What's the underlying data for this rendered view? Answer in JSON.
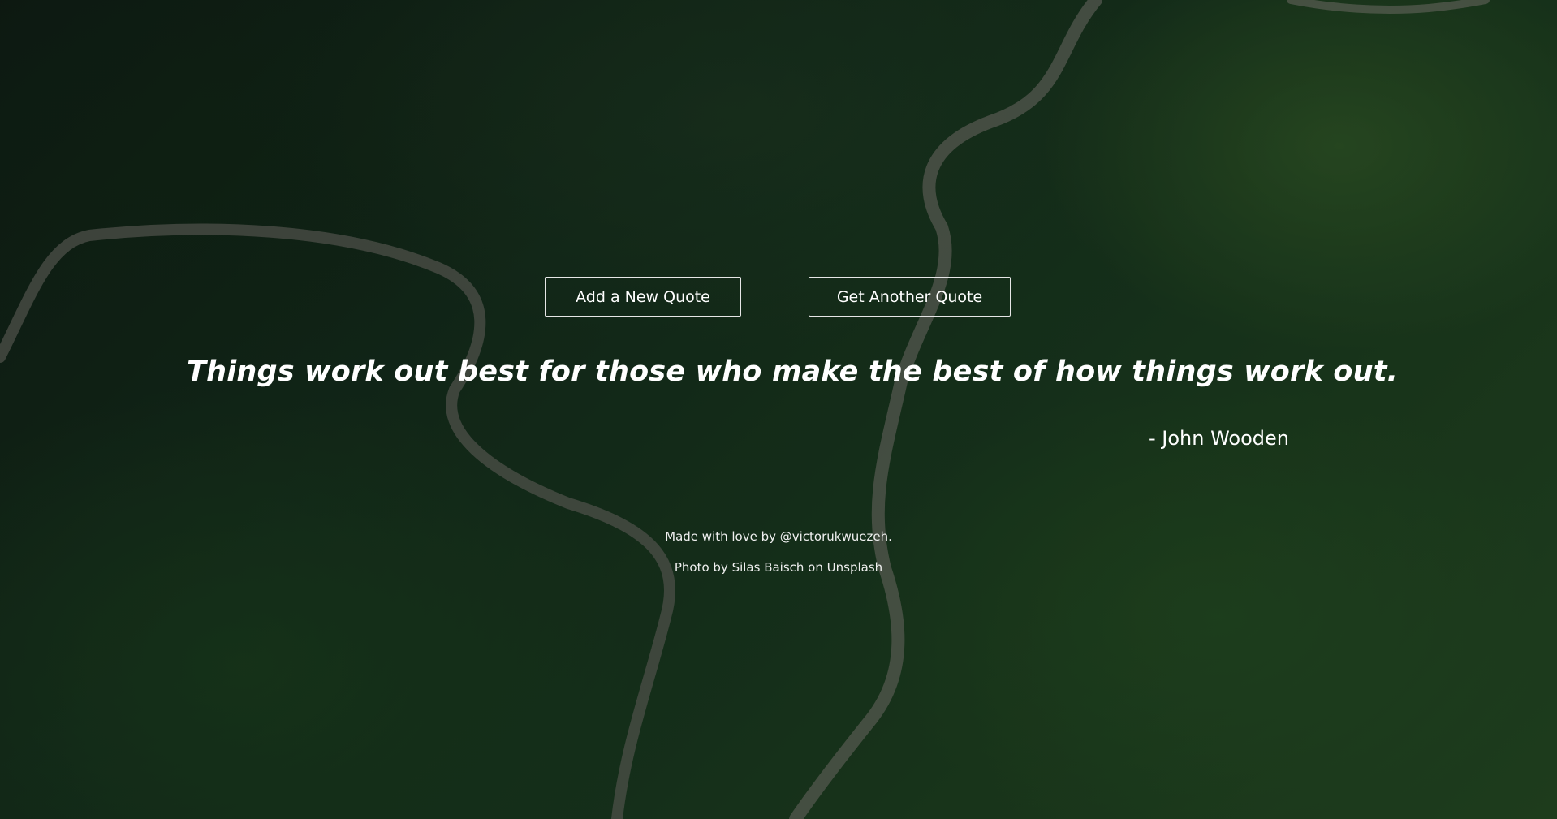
{
  "buttons": {
    "add_quote": "Add a New Quote",
    "another_quote": "Get Another Quote"
  },
  "quote": {
    "text": "Things work out best for those who make the best of how things work out.",
    "author": "- John Wooden"
  },
  "footer": {
    "credit": "Made with love by @victorukwuezeh.",
    "photo_credit": "Photo by Silas Baisch on Unsplash"
  },
  "colors": {
    "text": "#ffffff",
    "button_border": "#e6e6e6",
    "background_base": "#183521"
  }
}
